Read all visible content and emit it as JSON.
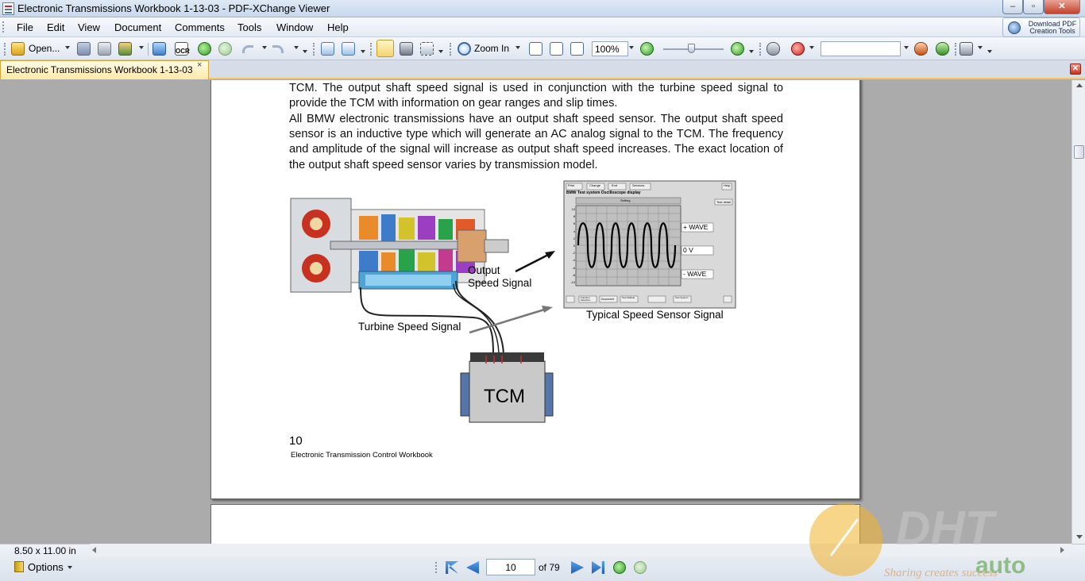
{
  "window": {
    "title": "Electronic Transmissions Workbook 1-13-03 - PDF-XChange Viewer",
    "minimize": "‒",
    "maximize": "▫",
    "close": "✕"
  },
  "menu": [
    "File",
    "Edit",
    "View",
    "Document",
    "Comments",
    "Tools",
    "Window",
    "Help"
  ],
  "download_button": {
    "line1": "Download PDF",
    "line2": "Creation Tools"
  },
  "toolbar": {
    "open_label": "Open...",
    "ocr_label": "OCR",
    "zoom_in_label": "Zoom In",
    "zoom_value": "100%",
    "search_value": ""
  },
  "tab": {
    "label": "Electronic Transmissions Workbook 1-13-03",
    "close": "×"
  },
  "document": {
    "paragraph1": "TCM.  The output shaft speed signal is used in conjunction with the turbine speed signal to provide the TCM with information on gear ranges and slip times.",
    "paragraph2": "All BMW electronic transmissions have an output shaft speed sensor.  The output shaft speed sensor is an inductive type which will generate an AC analog signal to the TCM.  The frequency and amplitude of the signal will increase as output shaft speed increases.  The exact location of the output shaft speed sensor varies by transmission model.",
    "figure": {
      "output_label_1": "Output",
      "output_label_2": "Speed Signal",
      "turbine_label": "Turbine Speed Signal",
      "tcm_label": "TCM",
      "scope_caption": "Typical Speed Sensor Signal",
      "scope_title": "BMW  Test system  Oscilloscope display",
      "wave_plus": "+ WAVE",
      "wave_zero": "0 V",
      "wave_minus": "- WAVE",
      "scope_buttons": [
        "Print",
        "Change",
        "End",
        "Services"
      ],
      "scope_help": "Help",
      "scope_test_detail": "Test detail",
      "scope_setting": "Setting",
      "scope_bottom_buttons": [
        "Function Selection",
        "Document",
        "Test Module",
        "Test System"
      ],
      "scope_ticks_y": [
        "10",
        "8",
        "6",
        "4",
        "2",
        "0",
        "-2",
        "-4",
        "-6",
        "-8",
        "-10"
      ]
    },
    "page_number": "10",
    "footer": "Electronic Transmission Control Workbook"
  },
  "status": {
    "page_size": "8.50 x 11.00 in",
    "options_label": "Options",
    "current_page": "10",
    "page_total": "of 79"
  },
  "watermark": {
    "brand": "DHT",
    "suffix": "auto",
    "tagline": "Sharing creates success"
  }
}
